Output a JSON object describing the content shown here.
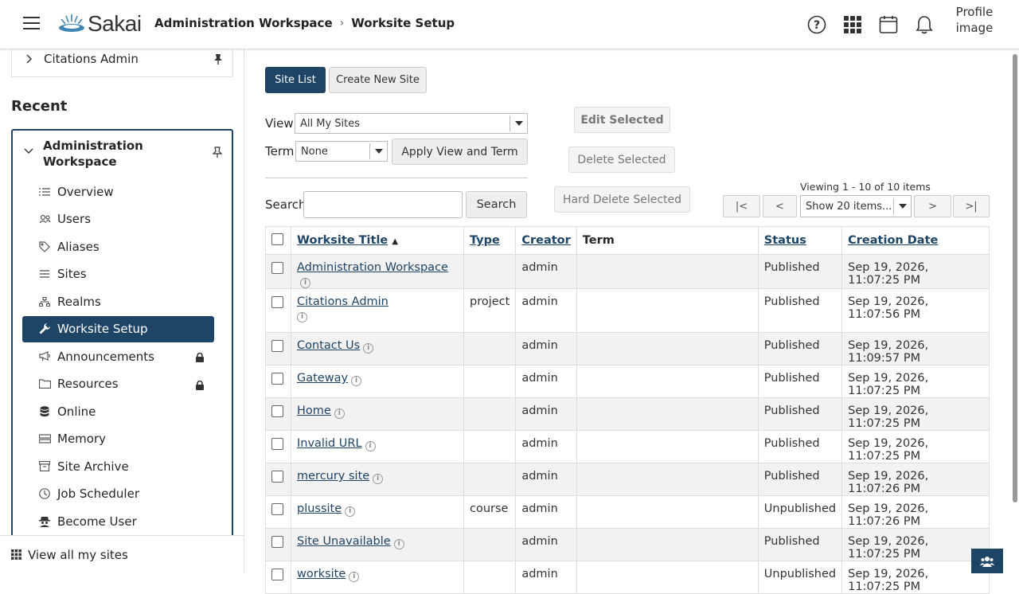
{
  "header": {
    "logo_text": "Sakai",
    "breadcrumb_workspace": "Administration Workspace",
    "breadcrumb_sep": "›",
    "breadcrumb_tool": "Worksite Setup",
    "profile_alt": "Profile image"
  },
  "sidebar": {
    "pinned_site": "Citations Admin",
    "recent_heading": "Recent",
    "workspace_title": "Administration Workspace",
    "tools": [
      {
        "label": "Overview",
        "icon": "list-icon"
      },
      {
        "label": "Users",
        "icon": "users-icon"
      },
      {
        "label": "Aliases",
        "icon": "tag-icon"
      },
      {
        "label": "Sites",
        "icon": "lines-icon"
      },
      {
        "label": "Realms",
        "icon": "hierarchy-icon"
      },
      {
        "label": "Worksite Setup",
        "icon": "wrench-icon",
        "active": true
      },
      {
        "label": "Announcements",
        "icon": "megaphone-icon",
        "locked": true
      },
      {
        "label": "Resources",
        "icon": "folder-icon",
        "locked": true
      },
      {
        "label": "Online",
        "icon": "database-icon"
      },
      {
        "label": "Memory",
        "icon": "memory-icon"
      },
      {
        "label": "Site Archive",
        "icon": "archive-icon"
      },
      {
        "label": "Job Scheduler",
        "icon": "clock-icon"
      },
      {
        "label": "Become User",
        "icon": "user-secret-icon"
      }
    ],
    "view_all": "View all my sites"
  },
  "main": {
    "site_list_tab": "Site List",
    "create_site_tab": "Create New Site",
    "view_label": "View",
    "view_value": "All My Sites",
    "term_label": "Term",
    "term_value": "None",
    "apply_button": "Apply View and Term",
    "edit_selected": "Edit Selected",
    "delete_selected": "Delete Selected",
    "hard_delete_selected": "Hard Delete Selected",
    "search_label": "Search",
    "search_button": "Search",
    "viewing": "Viewing 1 - 10 of 10 items",
    "page_first": "|<",
    "page_prev": "<",
    "page_size": "Show 20 items...",
    "page_next": ">",
    "page_last": ">|",
    "columns": {
      "title": "Worksite Title",
      "type": "Type",
      "creator": "Creator",
      "term": "Term",
      "status": "Status",
      "created": "Creation Date"
    },
    "rows": [
      {
        "title": "Administration Workspace",
        "type": "",
        "creator": "admin",
        "term": "",
        "status": "Published",
        "created": "Sep 19, 2026, 11:07:25 PM"
      },
      {
        "title": "Citations Admin",
        "type": "project",
        "creator": "admin",
        "term": "",
        "status": "Published",
        "created": "Sep 19, 2026, 11:07:56 PM"
      },
      {
        "title": "Contact Us",
        "type": "",
        "creator": "admin",
        "term": "",
        "status": "Published",
        "created": "Sep 19, 2026, 11:09:57 PM"
      },
      {
        "title": "Gateway",
        "type": "",
        "creator": "admin",
        "term": "",
        "status": "Published",
        "created": "Sep 19, 2026, 11:07:25 PM"
      },
      {
        "title": "Home",
        "type": "",
        "creator": "admin",
        "term": "",
        "status": "Published",
        "created": "Sep 19, 2026, 11:07:25 PM"
      },
      {
        "title": "Invalid URL",
        "type": "",
        "creator": "admin",
        "term": "",
        "status": "Published",
        "created": "Sep 19, 2026, 11:07:25 PM"
      },
      {
        "title": "mercury site",
        "type": "",
        "creator": "admin",
        "term": "",
        "status": "Published",
        "created": "Sep 19, 2026, 11:07:26 PM"
      },
      {
        "title": "plussite",
        "type": "course",
        "creator": "admin",
        "term": "",
        "status": "Unpublished",
        "created": "Sep 19, 2026, 11:07:26 PM"
      },
      {
        "title": "Site Unavailable",
        "type": "",
        "creator": "admin",
        "term": "",
        "status": "Published",
        "created": "Sep 19, 2026, 11:07:25 PM"
      },
      {
        "title": "worksite",
        "type": "",
        "creator": "admin",
        "term": "",
        "status": "Unpublished",
        "created": "Sep 19, 2026, 11:07:25 PM"
      }
    ]
  },
  "colors": {
    "brand": "#1e4466",
    "row_alt": "#f2f2f2"
  }
}
